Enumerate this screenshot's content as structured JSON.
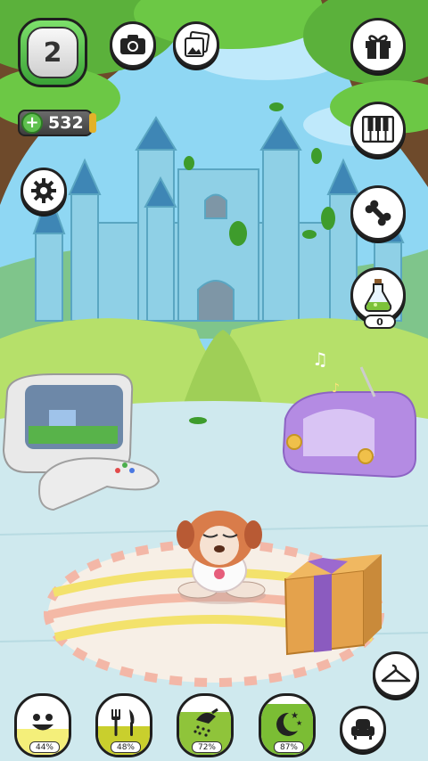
{
  "hud": {
    "level": "2",
    "coins": "532",
    "potion_count": "0"
  },
  "needs": [
    {
      "name": "happiness",
      "percent": "44%",
      "level": 0.44,
      "icon": "smiley-face-icon",
      "color": "#f4ef7a"
    },
    {
      "name": "food",
      "percent": "48%",
      "level": 0.48,
      "icon": "fork-knife-icon",
      "color": "#c9cf2d"
    },
    {
      "name": "hygiene",
      "percent": "72%",
      "level": 0.72,
      "icon": "shower-icon",
      "color": "#8fc43a"
    },
    {
      "name": "sleep",
      "percent": "87%",
      "level": 0.87,
      "icon": "moon-stars-icon",
      "color": "#7bbd34"
    }
  ],
  "colors": {
    "sky": "#8fd7f3",
    "castle": "#8fd0e6",
    "grass": "#b6e06a",
    "floor": "#cfe9ee",
    "button_border": "#222222",
    "radio": "#b48be3",
    "gift_box": "#e4a24c",
    "gift_ribbon": "#8b5bbf"
  },
  "icons": {
    "camera": "camera-icon",
    "photos": "photos-icon",
    "settings": "gear-icon",
    "gift": "gift-icon",
    "piano": "piano-keys-icon",
    "bone": "bone-icon",
    "potion": "potion-icon",
    "wardrobe": "hanger-icon",
    "room": "armchair-icon"
  }
}
